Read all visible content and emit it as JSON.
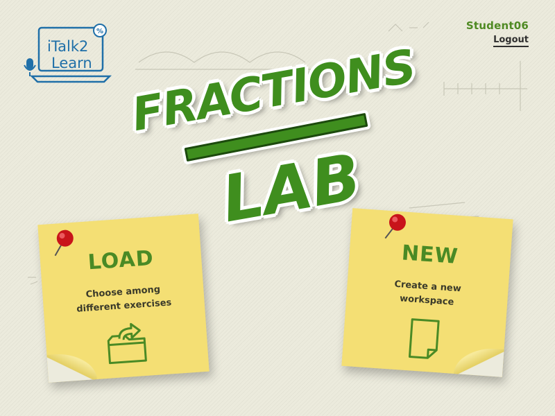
{
  "logo": {
    "line1": "iTalk2",
    "line2": "Learn",
    "badge": "%"
  },
  "user": {
    "name": "Student06",
    "logout_label": "Logout"
  },
  "title": {
    "word1": "FRACTIONS",
    "word2": "LAB"
  },
  "cards": {
    "load": {
      "title": "LOAD",
      "desc_line1": "Choose among",
      "desc_line2": "different exercises",
      "icon": "folder-open-icon"
    },
    "new": {
      "title": "NEW",
      "desc_line1": "Create a new",
      "desc_line2": "workspace",
      "icon": "new-document-icon"
    }
  },
  "colors": {
    "accent_green": "#4a8a25",
    "note_yellow": "#f4df74",
    "pin_red": "#c8141a",
    "logo_blue": "#1f6fa8"
  }
}
